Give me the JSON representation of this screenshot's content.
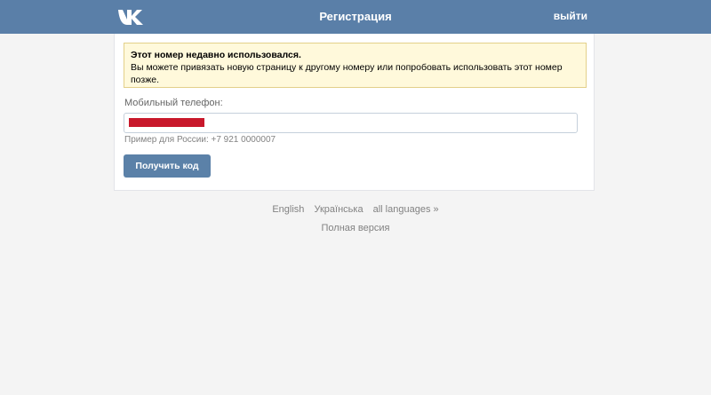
{
  "header": {
    "logo_icon": "vk-logo-icon",
    "title": "Регистрация",
    "logout_label": "выйти",
    "background_color": "#5a7fa8"
  },
  "notice": {
    "title": "Этот номер недавно использовался.",
    "text": "Вы можете привязать новую страницу к другому номеру или попробовать использовать этот номер позже.",
    "background_color": "#fff9db",
    "border_color": "#e3d08a"
  },
  "form": {
    "phone_label": "Мобильный телефон:",
    "phone_value_redacted": true,
    "redaction_color": "#c8182b",
    "phone_hint": "Пример для России: +7 921 0000007",
    "submit_label": "Получить код",
    "submit_color": "#5b81a8"
  },
  "footer": {
    "languages": [
      "English",
      "Українська",
      "all languages »"
    ],
    "full_version_label": "Полная версия"
  }
}
